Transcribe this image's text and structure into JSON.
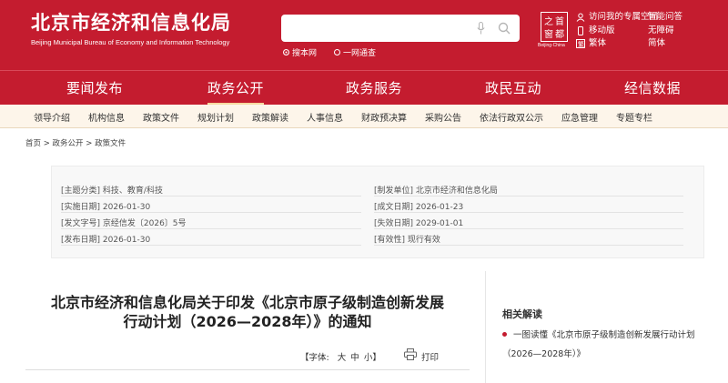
{
  "header": {
    "title": "北京市经济和信息化局",
    "subtitle": "Beijing Municipal Bureau of Economy and Information Technology",
    "search_placeholder": "",
    "scope_options": [
      "搜本网",
      "一网通查"
    ],
    "logo_text": "Beijing·China",
    "links": [
      "访问我的专属空间",
      "移动版",
      "繁体",
      "智能问答",
      "无障碍",
      "简体"
    ]
  },
  "main_nav": [
    "要闻发布",
    "政务公开",
    "政务服务",
    "政民互动",
    "经信数据"
  ],
  "sub_nav": [
    "领导介绍",
    "机构信息",
    "政策文件",
    "规划计划",
    "政策解读",
    "人事信息",
    "财政预决算",
    "采购公告",
    "依法行政双公示",
    "应急管理",
    "专题专栏"
  ],
  "breadcrumb": [
    "首页",
    ">",
    "政务公开",
    ">",
    "政策文件"
  ],
  "info": {
    "topic_label": "[主题分类]",
    "topic": "科技、教育/科技",
    "issuer_label": "[制发单位]",
    "issuer": "北京市经济和信息化局",
    "effective_label": "[实施日期]",
    "effective": "2026-01-30",
    "created_label": "[成文日期]",
    "created": "2026-01-23",
    "doc_no_label": "[发文字号]",
    "doc_no": "京经信发〔2026〕5号",
    "expire_label": "[失效日期]",
    "expire": "2029-01-01",
    "publish_label": "[发布日期]",
    "publish": "2026-01-30",
    "validity_label": "[有效性]",
    "validity": "现行有效"
  },
  "article": {
    "title_line1": "北京市经济和信息化局关于印发《北京市原子级制造创新发展",
    "title_line2": "行动计划（2026—2028年）》的通知",
    "font_label": "【字体:",
    "font_large": "大",
    "font_medium": "中",
    "font_small": "小】",
    "print_label": "打印"
  },
  "related": {
    "title": "相关解读",
    "items": [
      "一图读懂《北京市原子级制造创新发展行动计划（2026—2028年）》"
    ]
  },
  "colors": {
    "brand_red": "#c41c2f",
    "subnav_bg": "#fdf5ea",
    "active_bar": "#f6d9a0"
  }
}
